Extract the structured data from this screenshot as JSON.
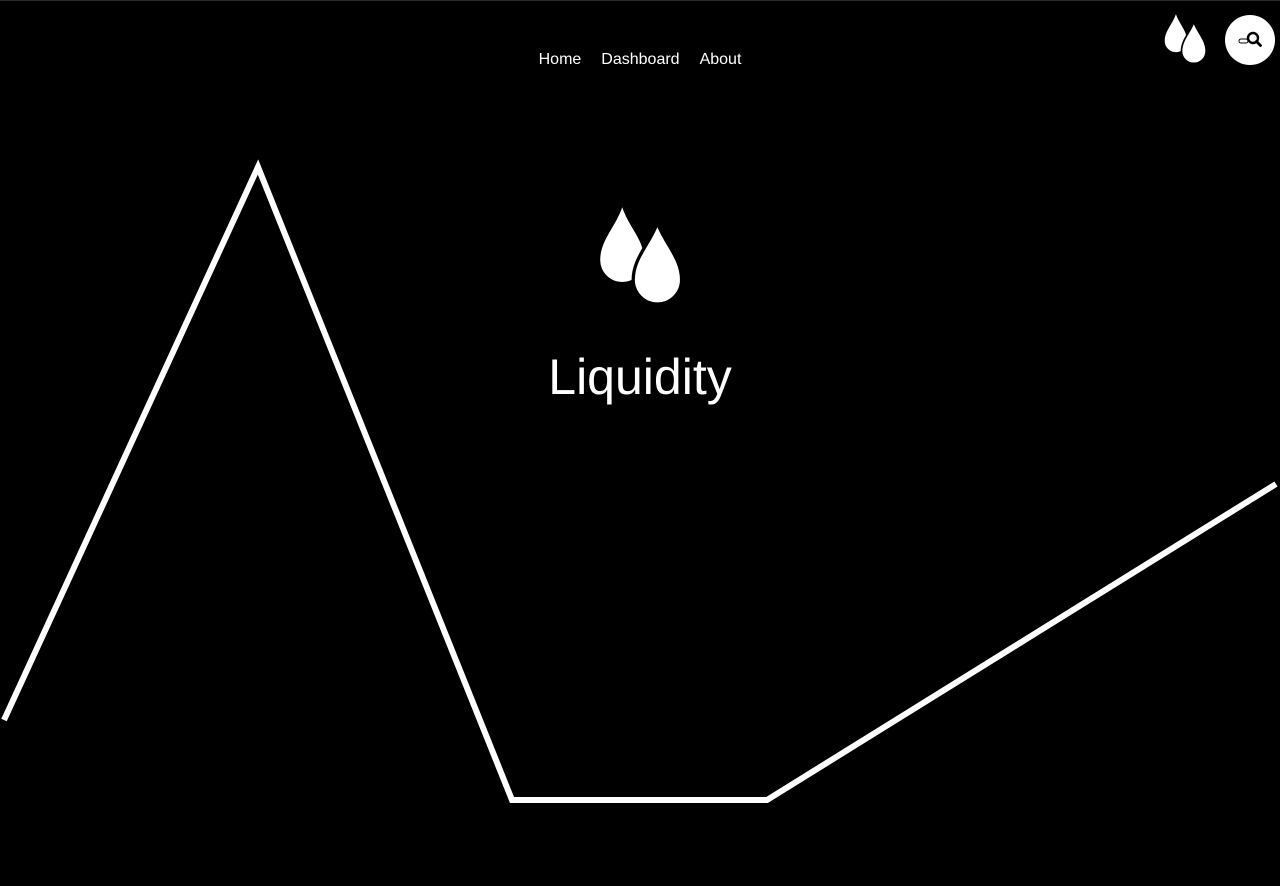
{
  "nav": {
    "items": [
      {
        "label": "Home"
      },
      {
        "label": "Dashboard"
      },
      {
        "label": "About"
      }
    ]
  },
  "header": {
    "logo_icon": "water-drops-icon",
    "search_icon": "magnifier-icon"
  },
  "hero": {
    "logo_icon": "water-drops-icon",
    "title": "Liquidity"
  },
  "colors": {
    "background": "#000000",
    "foreground": "#ffffff"
  }
}
